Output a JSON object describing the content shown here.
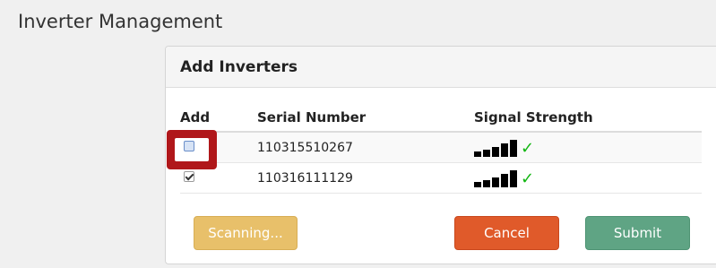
{
  "page": {
    "title": "Inverter Management"
  },
  "dialog": {
    "title": "Add Inverters",
    "columns": {
      "add": "Add",
      "serial": "Serial Number",
      "signal": "Signal Strength"
    },
    "rows": [
      {
        "serial": "110315510267",
        "checked": false,
        "highlighted": true,
        "signal_bars": 5,
        "signal_ok": true,
        "signal_ok_icon": "check-icon",
        "signal_ok_glyph": "✓"
      },
      {
        "serial": "110316111129",
        "checked": true,
        "highlighted": false,
        "signal_bars": 5,
        "signal_ok": true,
        "signal_ok_icon": "check-icon",
        "signal_ok_glyph": "✓"
      }
    ],
    "buttons": {
      "scanning": "Scanning...",
      "cancel": "Cancel",
      "submit": "Submit"
    }
  },
  "colors": {
    "highlight": "#b0171a",
    "scanning": "#e8c06a",
    "cancel": "#e05a2a",
    "submit": "#5fa484",
    "signal_ok": "#11b611"
  }
}
